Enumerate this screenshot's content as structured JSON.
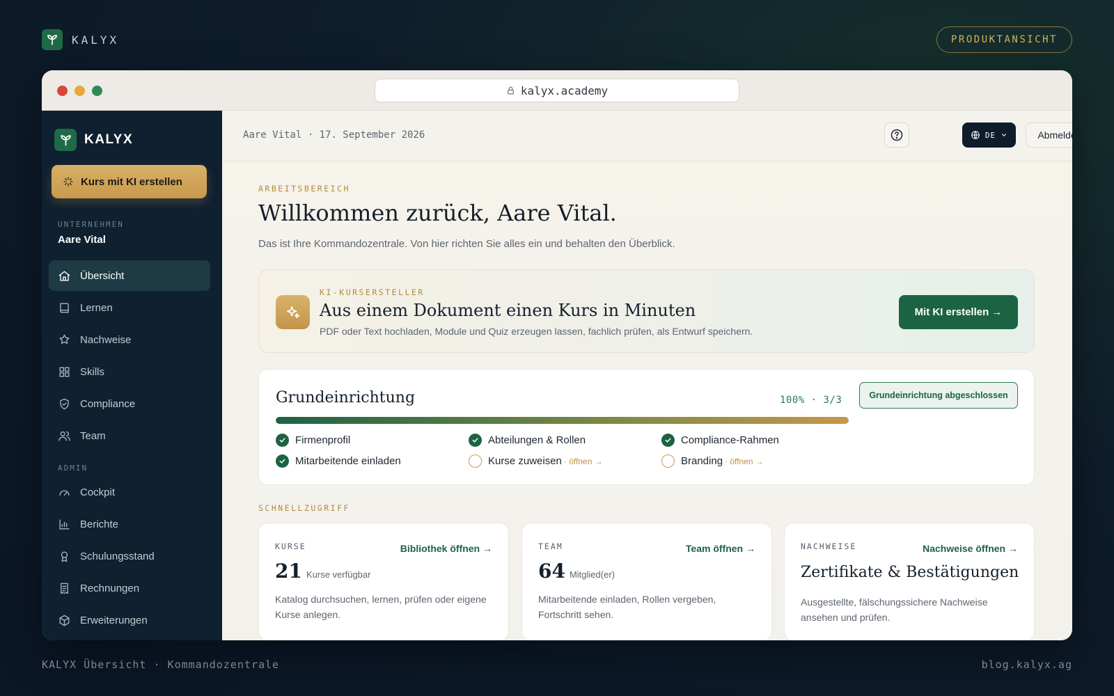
{
  "brand": {
    "name": "KALYX",
    "mode_pill": "PRODUKTANSICHT"
  },
  "browser": {
    "url": "kalyx.academy"
  },
  "sidebar": {
    "brand": "KALYX",
    "ai_button": "Kurs mit KI erstellen",
    "company_section": "UNTERNEHMEN",
    "company_name": "Aare Vital",
    "items": [
      {
        "label": "Übersicht",
        "icon": "home-icon",
        "active": true
      },
      {
        "label": "Lernen",
        "icon": "book-icon"
      },
      {
        "label": "Nachweise",
        "icon": "award-icon"
      },
      {
        "label": "Skills",
        "icon": "grid-icon"
      },
      {
        "label": "Compliance",
        "icon": "shield-check-icon"
      },
      {
        "label": "Team",
        "icon": "users-icon"
      }
    ],
    "admin_section": "ADMIN",
    "admin_items": [
      {
        "label": "Cockpit",
        "icon": "gauge-icon"
      },
      {
        "label": "Berichte",
        "icon": "bar-chart-icon"
      },
      {
        "label": "Schulungsstand",
        "icon": "medal-icon"
      },
      {
        "label": "Rechnungen",
        "icon": "receipt-icon"
      },
      {
        "label": "Erweiterungen",
        "icon": "package-icon"
      }
    ]
  },
  "topbar": {
    "breadcrumb": "Aare Vital · 17. September 2026",
    "help_icon": "help-circle-icon",
    "language": "DE",
    "logout": "Abmelden"
  },
  "welcome": {
    "eyebrow": "ARBEITSBEREICH",
    "title": "Willkommen zurück, Aare Vital.",
    "subtitle": "Das ist Ihre Kommandozentrale. Von hier richten Sie alles ein und behalten den Überblick."
  },
  "ai_card": {
    "eyebrow": "KI-KURSERSTELLER",
    "title": "Aus einem Dokument einen Kurs in Minuten",
    "subtitle": "PDF oder Text hochladen, Module und Quiz erzeugen lassen, fachlich prüfen, als Entwurf speichern.",
    "cta": "Mit KI erstellen →"
  },
  "setup": {
    "title": "Grundeinrichtung",
    "progress_text": "100% · 3/3",
    "progress": 1.0,
    "badge": "Grundeinrichtung abgeschlossen",
    "items": [
      {
        "label": "Firmenprofil",
        "done": true
      },
      {
        "label": "Abteilungen & Rollen",
        "done": true
      },
      {
        "label": "Compliance-Rahmen",
        "done": true
      },
      {
        "label": "Mitarbeitende einladen",
        "done": true
      },
      {
        "label": "Kurse zuweisen",
        "done": false,
        "link": "· öffnen →"
      },
      {
        "label": "Branding",
        "done": false,
        "link": "· öffnen →"
      }
    ]
  },
  "quick": {
    "eyebrow": "SCHNELLZUGRIFF",
    "courses": {
      "label": "KURSE",
      "link": "Bibliothek öffnen →",
      "value": "21",
      "unit": "Kurse verfügbar",
      "desc": "Katalog durchsuchen, lernen, prüfen oder eigene Kurse anlegen."
    },
    "team": {
      "label": "TEAM",
      "link": "Team öffnen →",
      "value": "64",
      "unit": "Mitglied(er)",
      "desc": "Mitarbeitende einladen, Rollen vergeben, Fortschritt sehen."
    },
    "proofs": {
      "label": "NACHWEISE",
      "link": "Nachweise öffnen →",
      "heading": "Zertifikate & Bestätigungen",
      "desc": "Ausgestellte, fälschungssichere Nachweise ansehen und prüfen."
    }
  },
  "footer": {
    "left": "KALYX Übersicht · Kommandozentrale",
    "right": "blog.kalyx.ag"
  },
  "colors": {
    "accent_green": "#1c6343",
    "accent_gold": "#c89a4d",
    "sidebar_bg": "#0f2030"
  }
}
